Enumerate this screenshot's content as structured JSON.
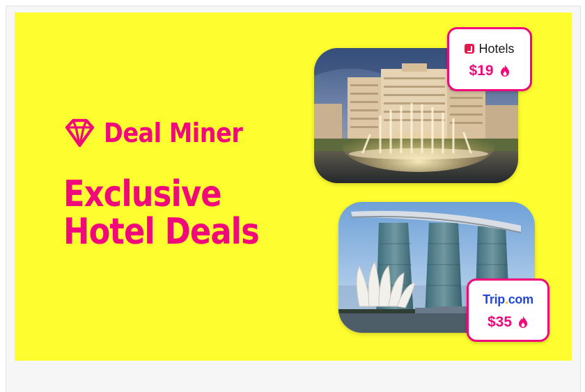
{
  "brand": {
    "name": "Deal Miner",
    "icon": "gem-icon",
    "color": "#f1087a"
  },
  "background_color": "#fdfd30",
  "headline": {
    "line1": "Exclusive",
    "line2": "Hotel Deals"
  },
  "deals": [
    {
      "provider": "Hotels",
      "provider_icon": "hotels-logo-icon",
      "price": "$19",
      "price_icon": "flame-icon",
      "photo": "las-vegas-hotel-fountain-photo"
    },
    {
      "provider_main": "Trip",
      "provider_dot": ".",
      "provider_suffix": "com",
      "price": "$35",
      "price_icon": "flame-icon",
      "photo": "singapore-skyline-hotel-photo"
    }
  ]
}
